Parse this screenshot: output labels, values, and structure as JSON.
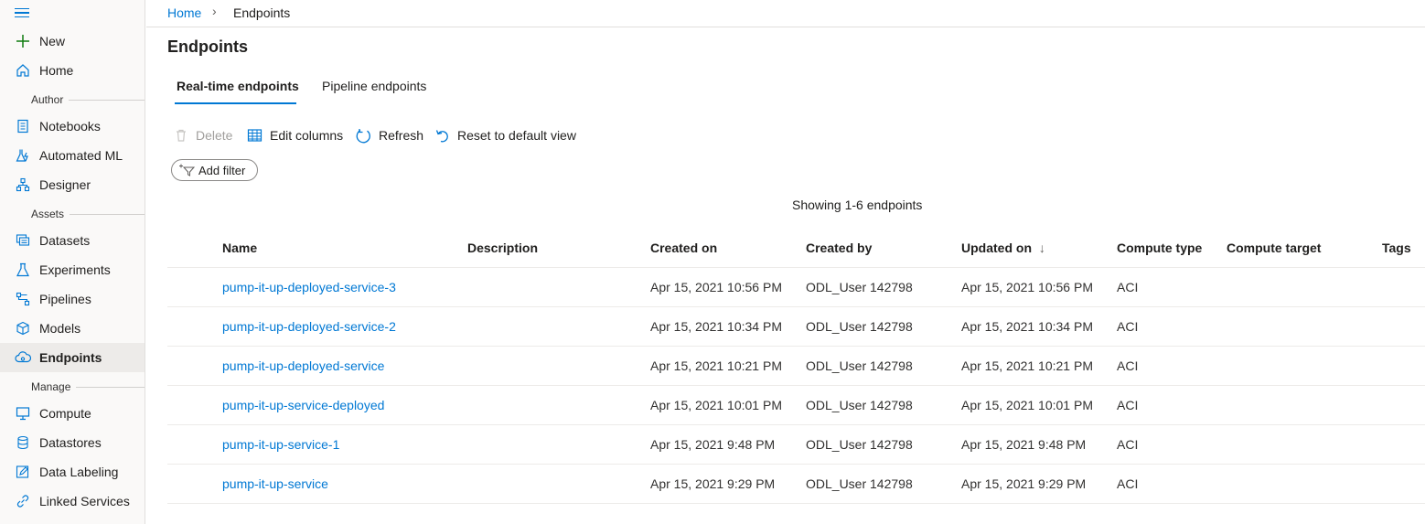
{
  "nav": {
    "new": "New",
    "home": "Home",
    "groups": {
      "author": "Author",
      "assets": "Assets",
      "manage": "Manage"
    },
    "author_items": [
      "Notebooks",
      "Automated ML",
      "Designer"
    ],
    "asset_items": [
      "Datasets",
      "Experiments",
      "Pipelines",
      "Models",
      "Endpoints"
    ],
    "manage_items": [
      "Compute",
      "Datastores",
      "Data Labeling",
      "Linked Services"
    ],
    "active": "Endpoints"
  },
  "breadcrumb": {
    "home": "Home",
    "separator": "›",
    "current": "Endpoints"
  },
  "page": {
    "title": "Endpoints"
  },
  "tabs": [
    {
      "label": "Real-time endpoints",
      "selected": true
    },
    {
      "label": "Pipeline endpoints",
      "selected": false
    }
  ],
  "toolbar": {
    "delete": "Delete",
    "edit_columns": "Edit columns",
    "refresh": "Refresh",
    "reset": "Reset to default view",
    "add_filter": "Add filter"
  },
  "summary": "Showing 1-6 endpoints",
  "table": {
    "columns": {
      "name": "Name",
      "description": "Description",
      "created_on": "Created on",
      "created_by": "Created by",
      "updated_on": "Updated on",
      "sort_indicator": "↓",
      "compute_type": "Compute type",
      "compute_target": "Compute target",
      "tags": "Tags"
    },
    "rows": [
      {
        "name": "pump-it-up-deployed-service-3",
        "created_on": "Apr 15, 2021 10:56 PM",
        "created_by": "ODL_User 142798",
        "updated_on": "Apr 15, 2021 10:56 PM",
        "compute_type": "ACI"
      },
      {
        "name": "pump-it-up-deployed-service-2",
        "created_on": "Apr 15, 2021 10:34 PM",
        "created_by": "ODL_User 142798",
        "updated_on": "Apr 15, 2021 10:34 PM",
        "compute_type": "ACI"
      },
      {
        "name": "pump-it-up-deployed-service",
        "created_on": "Apr 15, 2021 10:21 PM",
        "created_by": "ODL_User 142798",
        "updated_on": "Apr 15, 2021 10:21 PM",
        "compute_type": "ACI"
      },
      {
        "name": "pump-it-up-service-deployed",
        "created_on": "Apr 15, 2021 10:01 PM",
        "created_by": "ODL_User 142798",
        "updated_on": "Apr 15, 2021 10:01 PM",
        "compute_type": "ACI"
      },
      {
        "name": "pump-it-up-service-1",
        "created_on": "Apr 15, 2021 9:48 PM",
        "created_by": "ODL_User 142798",
        "updated_on": "Apr 15, 2021 9:48 PM",
        "compute_type": "ACI"
      },
      {
        "name": "pump-it-up-service",
        "created_on": "Apr 15, 2021 9:29 PM",
        "created_by": "ODL_User 142798",
        "updated_on": "Apr 15, 2021 9:29 PM",
        "compute_type": "ACI"
      }
    ]
  },
  "colors": {
    "accent": "#0078d4",
    "sidebar_bg": "#faf9f8",
    "active_bg": "#edebe9",
    "new_icon": "#107c10"
  },
  "icons": {
    "hamburger": "hamburger-icon",
    "new": "plus-icon",
    "home": "home-icon",
    "notebooks": "notebook-icon",
    "automated_ml": "flask-lightning-icon",
    "designer": "flow-icon",
    "datasets": "dataset-icon",
    "experiments": "flask-icon",
    "pipelines": "pipeline-icon",
    "models": "cube-icon",
    "endpoints": "cloud-icon",
    "compute": "monitor-icon",
    "datastores": "database-icon",
    "data_labeling": "edit-icon",
    "linked_services": "link-icon"
  }
}
